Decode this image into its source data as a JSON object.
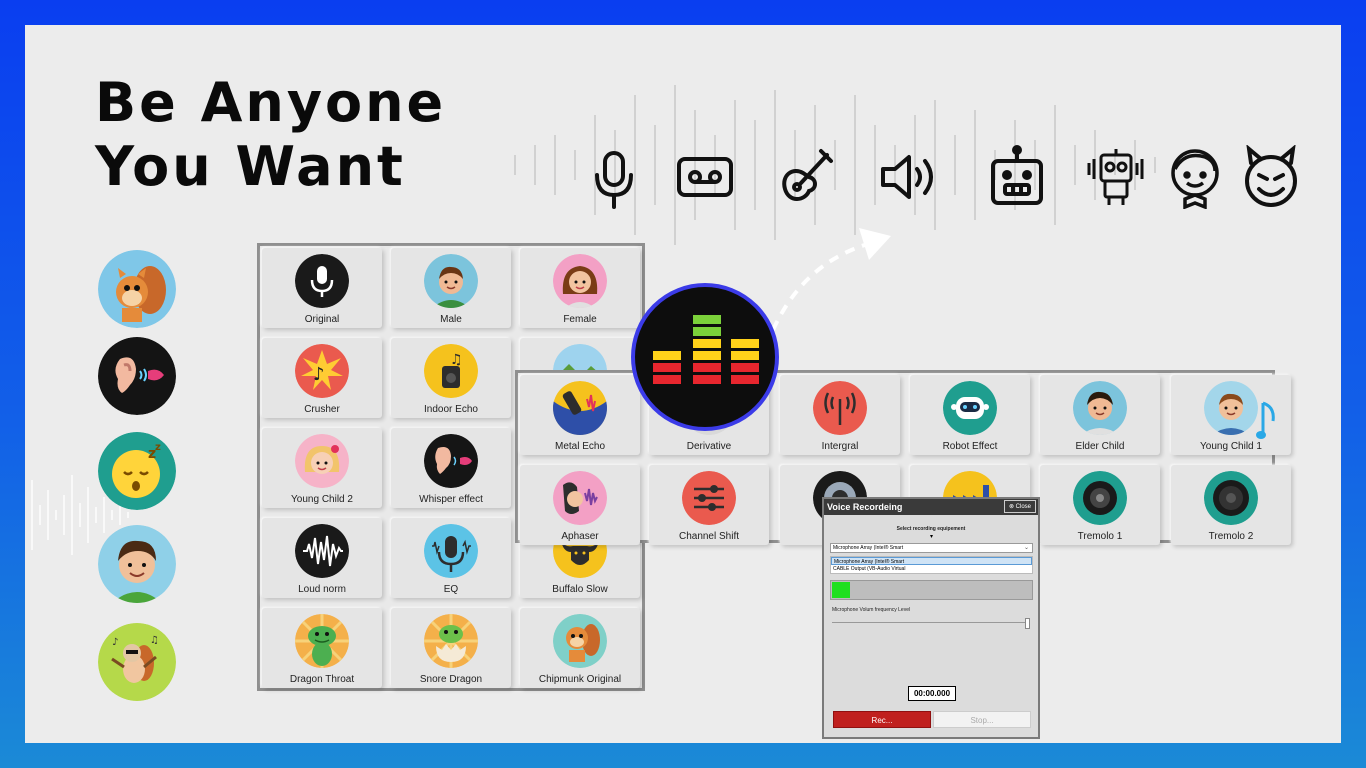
{
  "headline": {
    "line1": "Be Anyone",
    "line2": "You Want"
  },
  "top_icons": [
    "microphone-icon",
    "cassette-tape-icon",
    "guitar-icon",
    "speaker-icon",
    "robot-face-icon",
    "robot-icon",
    "boy-face-icon",
    "devil-face-icon"
  ],
  "side_avatars": [
    "squirrel",
    "ear-lips",
    "sleepy-emoji",
    "boy",
    "dancing-squirrel"
  ],
  "left_panel": {
    "tiles": [
      {
        "label": "Original",
        "icon": "microphone-icon"
      },
      {
        "label": "Male",
        "icon": "male-face-icon"
      },
      {
        "label": "Female",
        "icon": "female-face-icon"
      },
      {
        "label": "Crusher",
        "icon": "music-note-burst-icon"
      },
      {
        "label": "Indoor Echo",
        "icon": "speaker-music-icon"
      },
      {
        "label": "",
        "icon": "landscape-icon"
      },
      {
        "label": "Young Child 2",
        "icon": "girl-face-icon"
      },
      {
        "label": "Whisper effect",
        "icon": "ear-lips-icon"
      },
      {
        "label": "",
        "icon": "hidden"
      },
      {
        "label": "Loud norm",
        "icon": "soundwave-icon"
      },
      {
        "label": "EQ",
        "icon": "podcast-mic-icon"
      },
      {
        "label": "Buffalo Slow",
        "icon": "buffalo-icon"
      },
      {
        "label": "Dragon Throat",
        "icon": "dragon-icon"
      },
      {
        "label": "Snore Dragon",
        "icon": "dragon-egg-icon"
      },
      {
        "label": "Chipmunk Original",
        "icon": "chipmunk-icon"
      }
    ]
  },
  "right_panel": {
    "tiles": [
      {
        "label": "Metal Echo",
        "icon": "metal-echo-icon"
      },
      {
        "label": "Derivative",
        "icon": "derivative-icon"
      },
      {
        "label": "Intergral",
        "icon": "antenna-icon"
      },
      {
        "label": "Robot Effect",
        "icon": "robot-icon"
      },
      {
        "label": "Elder Child",
        "icon": "elder-child-icon"
      },
      {
        "label": "Young Child 1",
        "icon": "young-child-icon"
      },
      {
        "label": "Aphaser",
        "icon": "aphaser-icon"
      },
      {
        "label": "Channel Shift",
        "icon": "sliders-icon"
      },
      {
        "label": "",
        "icon": "speaker-icon"
      },
      {
        "label": "",
        "icon": "factory-icon"
      },
      {
        "label": "Tremolo 1",
        "icon": "tremolo-speaker-icon"
      },
      {
        "label": "Tremolo 2",
        "icon": "woofer-icon"
      }
    ]
  },
  "dialog": {
    "title": "Voice Recordeing",
    "close_label": "Close",
    "subtitle": "Select recording equipement",
    "selected_device": "Microphone Array (Intel® Smart",
    "options": [
      "Microphone Array (Intel® Smart",
      "CABLE Output (VB-Audio Virtual"
    ],
    "level_fraction": 0.09,
    "volume_label": "Microphone Volum frequency Level",
    "volume_fraction": 1.0,
    "timer": "00:00.000",
    "rec_label": "Rec...",
    "stop_label": "Stop..."
  },
  "colors": {
    "frame": "#0a3ef0",
    "rec": "#c0201e",
    "meter": "#1fe01f",
    "logo_ring": "#3b3be8"
  }
}
